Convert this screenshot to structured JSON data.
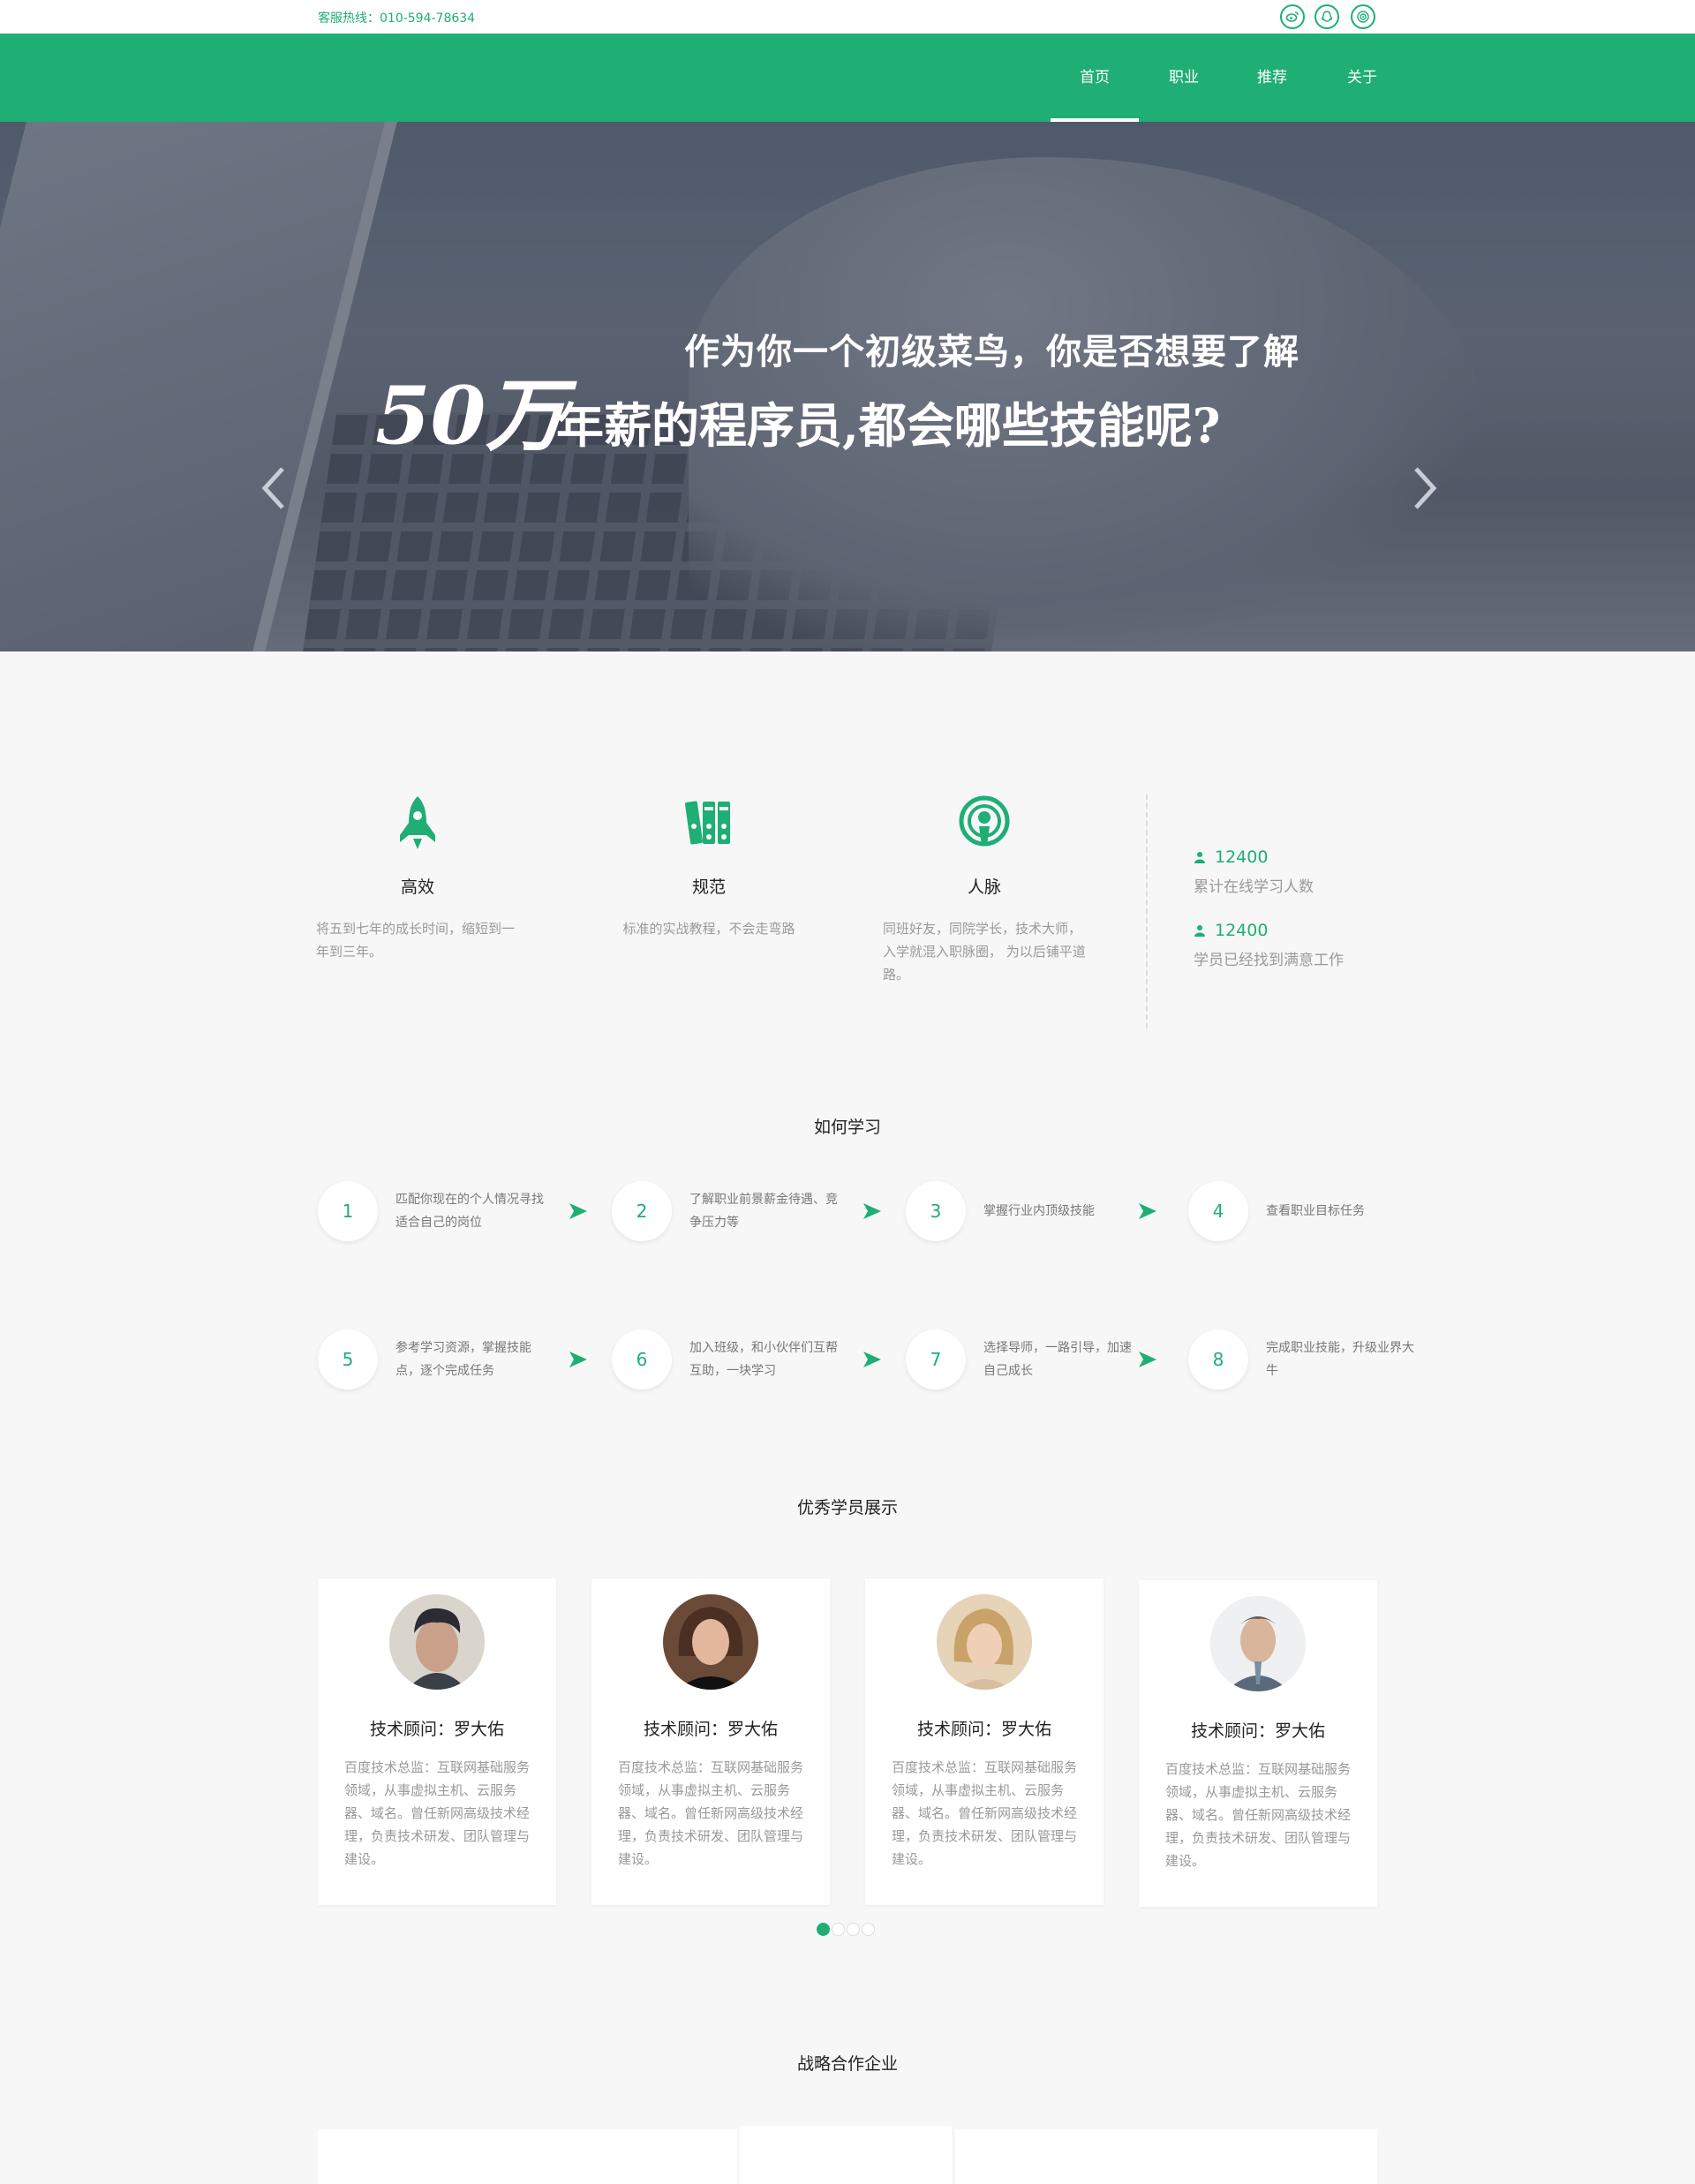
{
  "topbar": {
    "hotline": "客服热线：010-594-78634",
    "social_icons": [
      "weibo-icon",
      "qq-icon",
      "wechat-icon"
    ]
  },
  "nav": {
    "items": [
      {
        "label": "首页",
        "active": true
      },
      {
        "label": "职业",
        "active": false
      },
      {
        "label": "推荐",
        "active": false
      },
      {
        "label": "关于",
        "active": false
      }
    ]
  },
  "hero": {
    "line1": "作为你一个初级菜鸟，你是否想要了解",
    "big": "50万",
    "line2": "年薪的程序员,都会哪些技能呢?",
    "slide_count": 3
  },
  "features": [
    {
      "icon": "rocket-icon",
      "title": "高效",
      "desc": "将五到七年的成长时间，缩短到一年到三年。"
    },
    {
      "icon": "books-icon",
      "title": "规范",
      "desc": "标准的实战教程，不会走弯路"
    },
    {
      "icon": "podcast-icon",
      "title": "人脉",
      "desc": "同班好友，同院学长，技术大师，入学就混入职脉圈， 为以后铺平道路。"
    }
  ],
  "stats": [
    {
      "value": "12400",
      "label": "累计在线学习人数"
    },
    {
      "value": "12400",
      "label": "学员已经找到满意工作"
    }
  ],
  "how": {
    "title": "如何学习",
    "steps": [
      {
        "num": "1",
        "text": "匹配你现在的个人情况寻找适合自己的岗位"
      },
      {
        "num": "2",
        "text": "了解职业前景薪金待遇、竞争压力等"
      },
      {
        "num": "3",
        "text": "掌握行业内顶级技能"
      },
      {
        "num": "4",
        "text": "查看职业目标任务"
      },
      {
        "num": "5",
        "text": "参考学习资源，掌握技能点，逐个完成任务"
      },
      {
        "num": "6",
        "text": "加入班级，和小伙伴们互帮互助，一块学习"
      },
      {
        "num": "7",
        "text": "选择导师，一路引导，加速自己成长"
      },
      {
        "num": "8",
        "text": "完成职业技能，升级业界大牛"
      }
    ]
  },
  "students": {
    "title": "优秀学员展示",
    "items": [
      {
        "name": "技术顾问：罗大佑",
        "desc": "百度技术总监：互联网基础服务领域，从事虚拟主机、云服务器、域名。曾任新网高级技术经理，负责技术研发、团队管理与建设。"
      },
      {
        "name": "技术顾问：罗大佑",
        "desc": "百度技术总监：互联网基础服务领域，从事虚拟主机、云服务器、域名。曾任新网高级技术经理，负责技术研发、团队管理与建设。"
      },
      {
        "name": "技术顾问：罗大佑",
        "desc": "百度技术总监：互联网基础服务领域，从事虚拟主机、云服务器、域名。曾任新网高级技术经理，负责技术研发、团队管理与建设。"
      },
      {
        "name": "技术顾问：罗大佑",
        "desc": "百度技术总监：互联网基础服务领域，从事虚拟主机、云服务器、域名。曾任新网高级技术经理，负责技术研发、团队管理与建设。"
      }
    ],
    "page_count": 4
  },
  "partners": {
    "title": "战略合作企业"
  },
  "colors": {
    "accent": "#1fae74"
  }
}
